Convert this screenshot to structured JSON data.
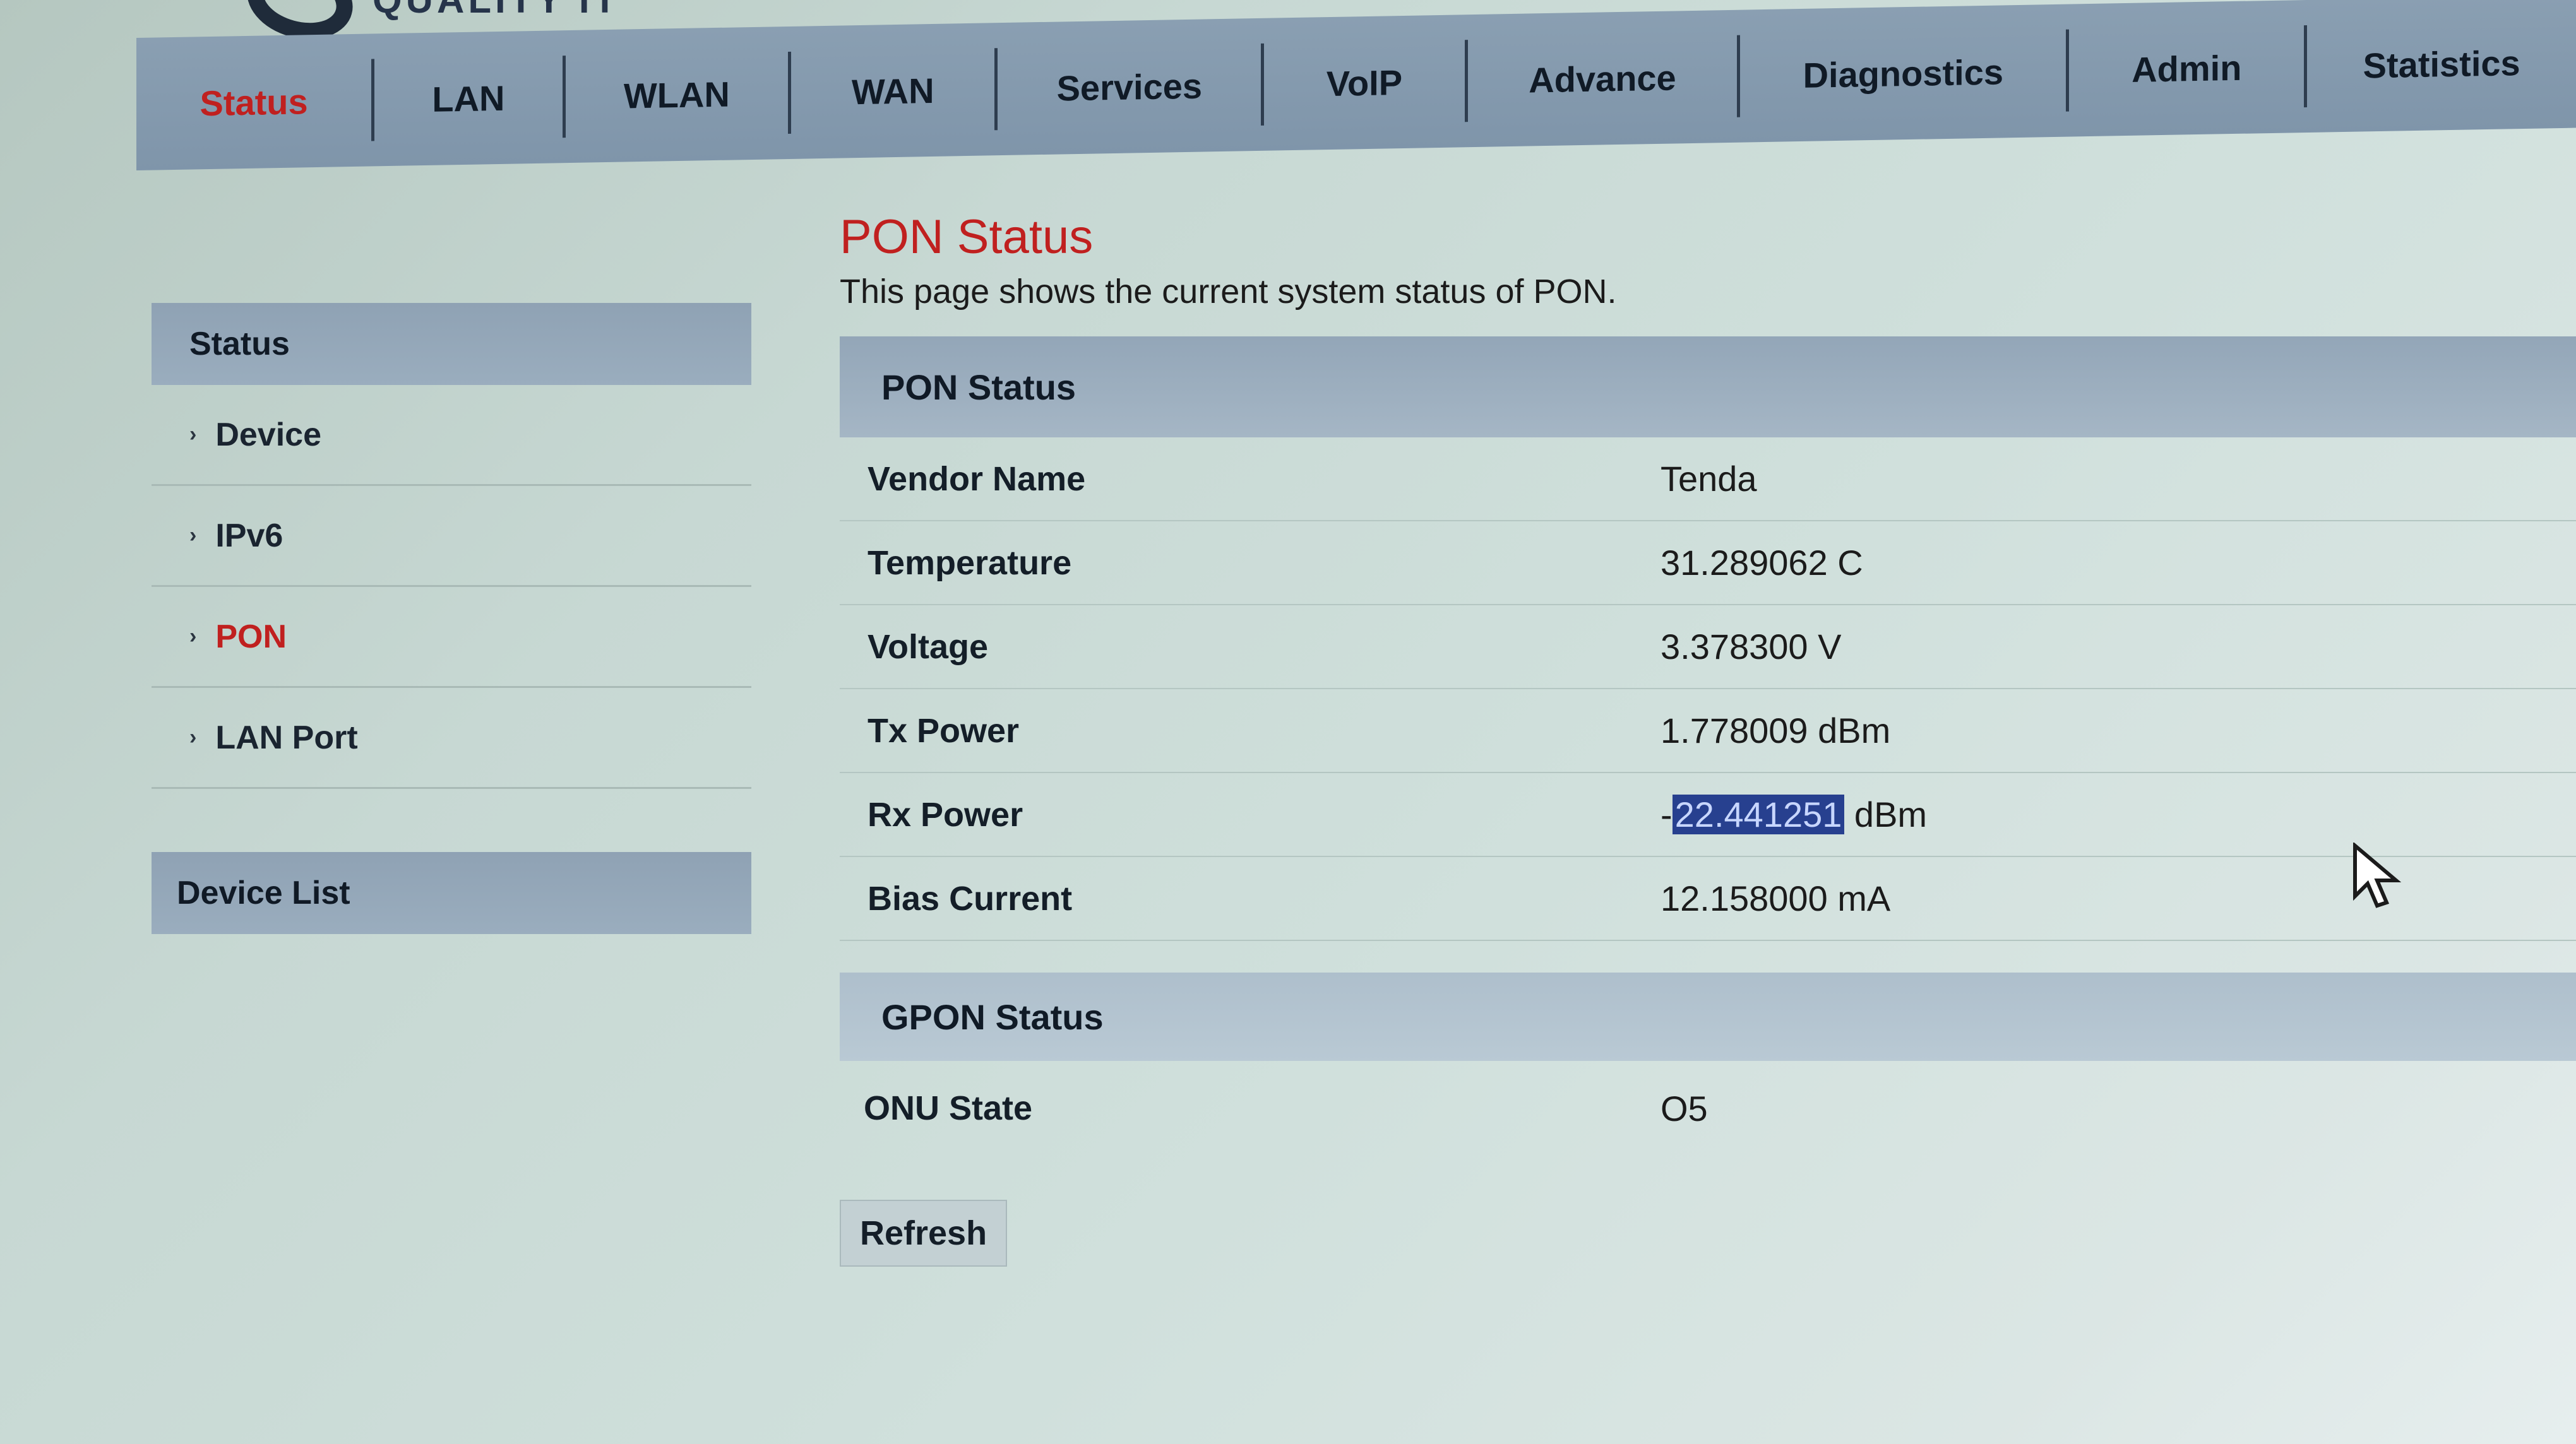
{
  "logo": {
    "text": "QUALITY IT"
  },
  "nav": {
    "items": [
      {
        "label": "Status",
        "active": true
      },
      {
        "label": "LAN",
        "active": false
      },
      {
        "label": "WLAN",
        "active": false
      },
      {
        "label": "WAN",
        "active": false
      },
      {
        "label": "Services",
        "active": false
      },
      {
        "label": "VoIP",
        "active": false
      },
      {
        "label": "Advance",
        "active": false
      },
      {
        "label": "Diagnostics",
        "active": false
      },
      {
        "label": "Admin",
        "active": false
      },
      {
        "label": "Statistics",
        "active": false
      }
    ]
  },
  "sidebar": {
    "header": "Status",
    "items": [
      {
        "label": "Device",
        "active": false
      },
      {
        "label": "IPv6",
        "active": false
      },
      {
        "label": "PON",
        "active": true
      },
      {
        "label": "LAN Port",
        "active": false
      }
    ],
    "device_list": "Device List"
  },
  "main": {
    "title": "PON Status",
    "description": "This page shows the current system status of PON.",
    "pon_section": {
      "header": "PON Status",
      "rows": [
        {
          "label": "Vendor Name",
          "value": "Tenda"
        },
        {
          "label": "Temperature",
          "value": "31.289062 C"
        },
        {
          "label": "Voltage",
          "value": "3.378300 V"
        },
        {
          "label": "Tx Power",
          "value": "1.778009 dBm"
        },
        {
          "label": "Rx Power",
          "value_prefix": "-",
          "value_selected": "22.441251",
          "value_suffix": " dBm"
        },
        {
          "label": "Bias Current",
          "value": "12.158000 mA"
        }
      ]
    },
    "gpon_section": {
      "header": "GPON Status",
      "rows": [
        {
          "label": "ONU State",
          "value": "O5"
        }
      ]
    },
    "refresh_label": "Refresh"
  },
  "colors": {
    "accent_red": "#c0201f",
    "nav_bg": "#8a9fb2",
    "selection_bg": "#27408f"
  }
}
